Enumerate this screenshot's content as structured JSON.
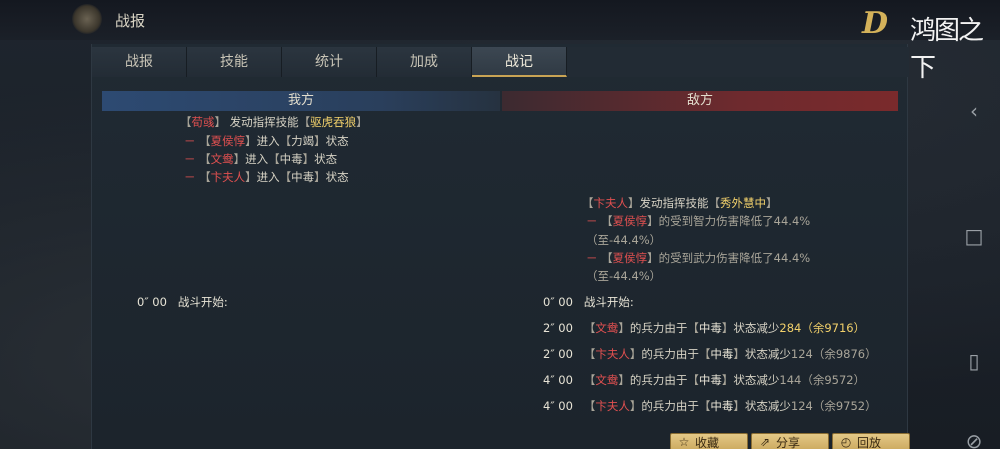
{
  "header": {
    "title": "战报",
    "logo_mark": "D",
    "logo_text": "鸿图之下"
  },
  "tabs": [
    {
      "label": "战报",
      "active": false
    },
    {
      "label": "技能",
      "active": false
    },
    {
      "label": "统计",
      "active": false
    },
    {
      "label": "加成",
      "active": false
    },
    {
      "label": "战记",
      "active": true
    }
  ],
  "sections": {
    "mine": "我方",
    "enemy": "敌方"
  },
  "mine_log": {
    "line1": {
      "name": "荀彧",
      "text": "发动指挥技能",
      "skill": "驱虎吞狼"
    },
    "line2": {
      "dash": "－",
      "name": "夏侯惇",
      "text": "进入",
      "state": "力竭",
      "suffix": "状态"
    },
    "line3": {
      "dash": "－",
      "name": "文鸯",
      "text": "进入",
      "state": "中毒",
      "suffix": "状态"
    },
    "line4": {
      "dash": "－",
      "name": "卞夫人",
      "text": "进入",
      "state": "中毒",
      "suffix": "状态"
    },
    "start": {
      "time": "0″ 00",
      "text": "战斗开始:"
    }
  },
  "enemy_log": {
    "line1": {
      "name": "卞夫人",
      "text": "发动指挥技能",
      "skill": "秀外慧中"
    },
    "line2": {
      "dash": "－",
      "name": "夏侯惇",
      "text": "的受到智力伤害降低了44.4%"
    },
    "line3": {
      "text": "（至-44.4%）"
    },
    "line4": {
      "dash": "－",
      "name": "夏侯惇",
      "text": "的受到武力伤害降低了44.4%"
    },
    "line5": {
      "text": "（至-44.4%）"
    },
    "start": {
      "time": "0″ 00",
      "text": "战斗开始:"
    },
    "events": [
      {
        "time": "2″ 00",
        "name": "文鸯",
        "text1": "的兵力由于",
        "state": "中毒",
        "text2": "状态减少",
        "value": "284",
        "rest": "（余9716）",
        "highlight": true
      },
      {
        "time": "2″ 00",
        "name": "卞夫人",
        "text1": "的兵力由于",
        "state": "中毒",
        "text2": "状态减少",
        "value": "124",
        "rest": "（余9876）",
        "highlight": false
      },
      {
        "time": "4″ 00",
        "name": "文鸯",
        "text1": "的兵力由于",
        "state": "中毒",
        "text2": "状态减少",
        "value": "144",
        "rest": "（余9572）",
        "highlight": false
      },
      {
        "time": "4″ 00",
        "name": "卞夫人",
        "text1": "的兵力由于",
        "state": "中毒",
        "text2": "状态减少",
        "value": "124",
        "rest": "（余9752）",
        "highlight": false
      }
    ]
  },
  "buttons": {
    "favorite": {
      "label": "收藏",
      "icon": "star-icon"
    },
    "share": {
      "label": "分享",
      "icon": "share-icon"
    },
    "replay": {
      "label": "回放",
      "icon": "replay-icon"
    }
  },
  "colors": {
    "name_red": "#e05050",
    "skill_gold": "#f2d16b",
    "tab_underline": "#c9a454",
    "mine_header": "#2d4a72",
    "enemy_header": "#7a2a2c",
    "button_gold": "#d9b870"
  }
}
